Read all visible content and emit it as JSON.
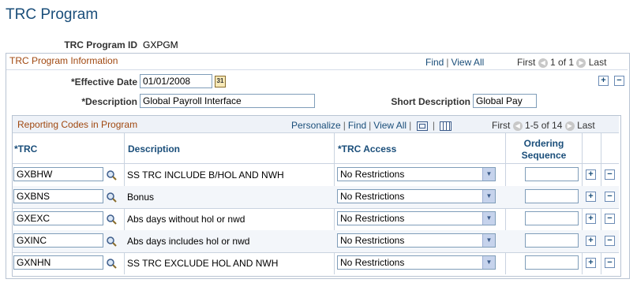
{
  "page_title": "TRC Program",
  "program_id": {
    "label": "TRC Program ID",
    "value": "GXPGM"
  },
  "info_section": {
    "title": "TRC Program Information",
    "nav": {
      "find": "Find",
      "view_all": "View All",
      "first": "First",
      "range": "1 of 1",
      "last": "Last"
    },
    "effective_date": {
      "label": "*Effective Date",
      "value": "01/01/2008"
    },
    "description": {
      "label": "*Description",
      "value": "Global Payroll Interface"
    },
    "short_description": {
      "label": "Short Description",
      "value": "Global Pay"
    }
  },
  "grid": {
    "title": "Reporting Codes in Program",
    "nav": {
      "personalize": "Personalize",
      "find": "Find",
      "view_all": "View All",
      "first": "First",
      "range": "1-5 of 14",
      "last": "Last"
    },
    "columns": {
      "trc": "*TRC",
      "description": "Description",
      "trc_access": "*TRC Access",
      "ordering_line1": "Ordering",
      "ordering_line2": "Sequence"
    },
    "rows": [
      {
        "trc": "GXBHW",
        "description": "SS TRC INCLUDE B/HOL AND NWH",
        "access": "No Restrictions",
        "sequence": ""
      },
      {
        "trc": "GXBNS",
        "description": "Bonus",
        "access": "No Restrictions",
        "sequence": ""
      },
      {
        "trc": "GXEXC",
        "description": "Abs days without hol or nwd",
        "access": "No Restrictions",
        "sequence": ""
      },
      {
        "trc": "GXINC",
        "description": "Abs days includes hol or nwd",
        "access": "No Restrictions",
        "sequence": ""
      },
      {
        "trc": "GXNHN",
        "description": "SS TRC EXCLUDE HOL AND NWH",
        "access": "No Restrictions",
        "sequence": ""
      }
    ]
  },
  "icons": {
    "add": "+",
    "delete": "−",
    "calendar": "calendar-icon",
    "lookup": "magnifier-icon"
  },
  "colors": {
    "title": "#1a4e7a",
    "section_title": "#a04810",
    "border": "#b9c4d3"
  }
}
